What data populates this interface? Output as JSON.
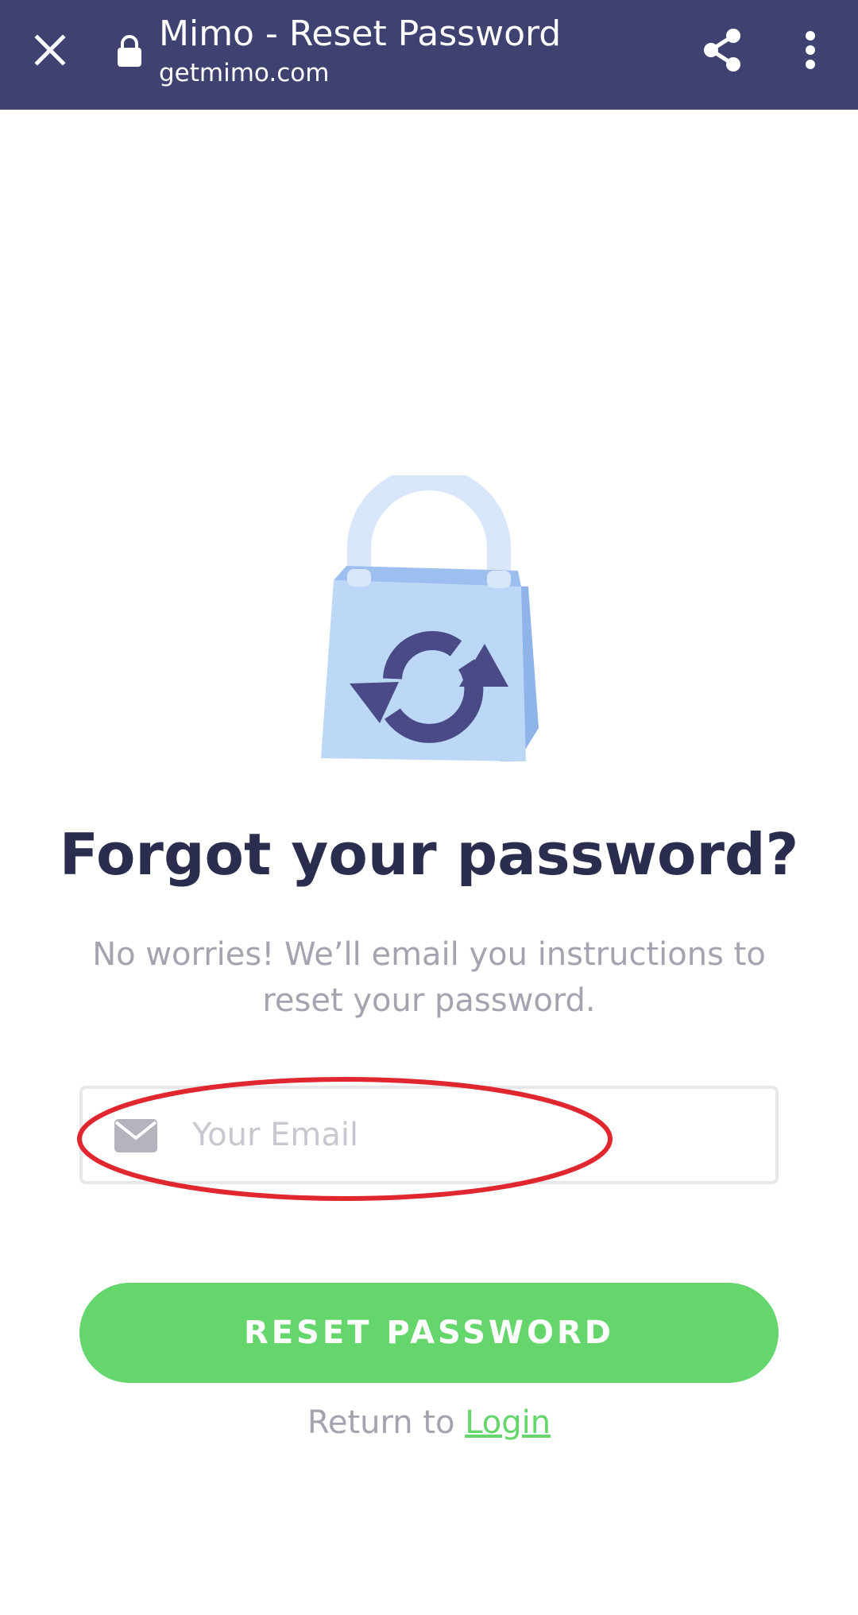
{
  "browser": {
    "title": "Mimo - Reset Password",
    "url": "getmimo.com",
    "icons": {
      "close": "close-icon",
      "lock": "lock-icon",
      "share": "share-icon",
      "more": "more-vertical-icon"
    }
  },
  "page": {
    "illustration": "padlock-reset-icon",
    "heading": "Forgot your password?",
    "subtitle": "No worries! We’ll email you instructions to reset your password.",
    "email_field": {
      "placeholder": "Your Email",
      "value": "",
      "icon": "mail-icon"
    },
    "reset_button_label": "RESET PASSWORD",
    "return_text": "Return to",
    "login_link_label": "Login"
  },
  "colors": {
    "browser_bar": "#3f4270",
    "heading": "#2b2d4f",
    "muted_text": "#a3a4b0",
    "accent_green": "#64d66c",
    "annotation_red": "#e0262e"
  }
}
